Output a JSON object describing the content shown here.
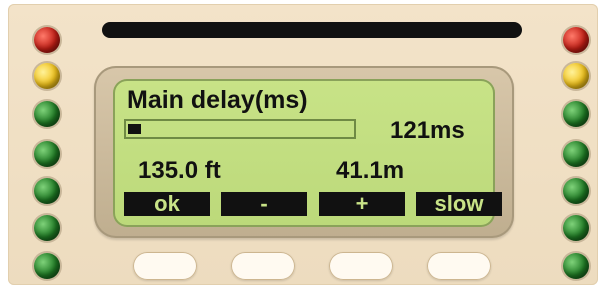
{
  "display": {
    "title": "Main delay(ms)",
    "delay_value": "121ms",
    "distance_feet": "135.0 ft",
    "distance_meters": "41.1m",
    "progress_fraction": 0.06
  },
  "softkeys": [
    {
      "label": "ok"
    },
    {
      "label": "-"
    },
    {
      "label": "+"
    },
    {
      "label": "slow"
    }
  ],
  "leds": {
    "left": [
      "red",
      "yellow",
      "green",
      "green",
      "green",
      "green",
      "green"
    ],
    "right": [
      "red",
      "yellow",
      "green",
      "green",
      "green",
      "green",
      "green"
    ]
  },
  "colors": {
    "lcd_background": "#c8e387",
    "lcd_text": "#111111",
    "panel": "#f3e3c9"
  }
}
